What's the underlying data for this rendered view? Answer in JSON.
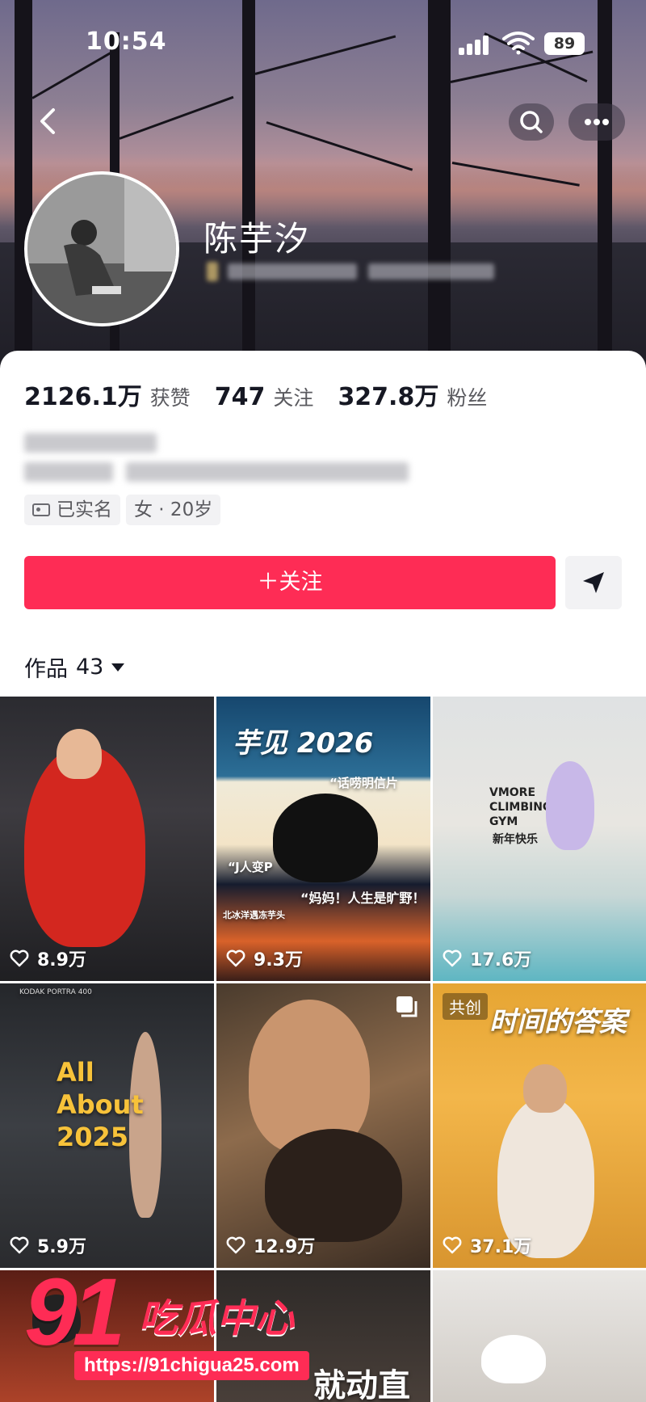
{
  "status_bar": {
    "time": "10:54",
    "battery": "89"
  },
  "profile": {
    "nickname": "陈芋汐",
    "stats": [
      {
        "value": "2126.1万",
        "label": "获赞"
      },
      {
        "value": "747",
        "label": "关注"
      },
      {
        "value": "327.8万",
        "label": "粉丝"
      }
    ],
    "tags": {
      "verified": "已实名",
      "gender_age": "女 · 20岁"
    },
    "follow_label": "＋关注"
  },
  "works": {
    "tab_label": "作品",
    "count": "43"
  },
  "videos": [
    {
      "likes": "8.9万"
    },
    {
      "likes": "9.3万",
      "overlay": "芋见 2026",
      "caption1": "“话唠明信片",
      "caption2": "“J人变P",
      "caption3": "“妈妈！人生是旷野！",
      "caption4": "北冰洋遇冻芋头"
    },
    {
      "likes": "17.6万",
      "overlay": "VMORE CLIMBING GYM",
      "caption1": "新年快乐"
    },
    {
      "likes": "5.9万",
      "film_label": "KODAK PORTRA 400",
      "overlay": "All About 2025"
    },
    {
      "likes": "12.9万"
    },
    {
      "likes": "37.1万",
      "badge": "共创",
      "overlay": "时间的答案"
    },
    {
      "likes": ""
    },
    {
      "likes": "",
      "overlay": "就动直"
    },
    {
      "likes": ""
    }
  ],
  "watermark": {
    "brand_number": "91",
    "brand_text": "吃瓜中心",
    "url": "https://91chigua25.com"
  },
  "colors": {
    "accent": "#fe2c55",
    "text": "#161823"
  }
}
